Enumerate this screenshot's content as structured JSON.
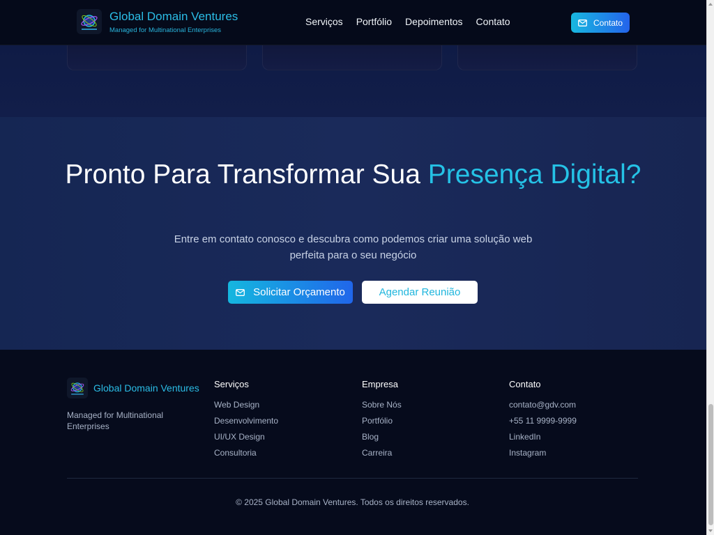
{
  "header": {
    "brand_title": "Global Domain Ventures",
    "brand_subtitle": "Managed for Multinational Enterprises",
    "nav": [
      "Serviços",
      "Portfólio",
      "Depoimentos",
      "Contato"
    ],
    "contact_button": "Contato"
  },
  "cta": {
    "title_part1": "Pronto Para Transformar Sua ",
    "title_highlight": "Presença Digital?",
    "description_line1": "Entre em contato conosco e descubra como podemos criar uma solução web",
    "description_line2": "perfeita para o seu negócio",
    "primary_button": "Solicitar Orçamento",
    "secondary_button": "Agendar Reunião"
  },
  "footer": {
    "brand_title": "Global Domain Ventures",
    "description": "Managed for Multinational Enterprises",
    "columns": [
      {
        "title": "Serviços",
        "links": [
          "Web Design",
          "Desenvolvimento",
          "UI/UX Design",
          "Consultoria"
        ]
      },
      {
        "title": "Empresa",
        "links": [
          "Sobre Nós",
          "Portfólio",
          "Blog",
          "Carreira"
        ]
      },
      {
        "title": "Contato",
        "links": [
          "contato@gdv.com",
          "+55 11 9999-9999",
          "LinkedIn",
          "Instagram"
        ]
      }
    ],
    "copyright": "© 2025 Global Domain Ventures. Todos os direitos reservados."
  },
  "colors": {
    "accent": "#25c2e6",
    "gradient_start": "#15b7df",
    "gradient_end": "#2066ea",
    "background": "#060b1c"
  },
  "icons": {
    "logo": "globe-logo-icon",
    "contact_button": "mail-icon",
    "primary_button": "mail-icon"
  }
}
